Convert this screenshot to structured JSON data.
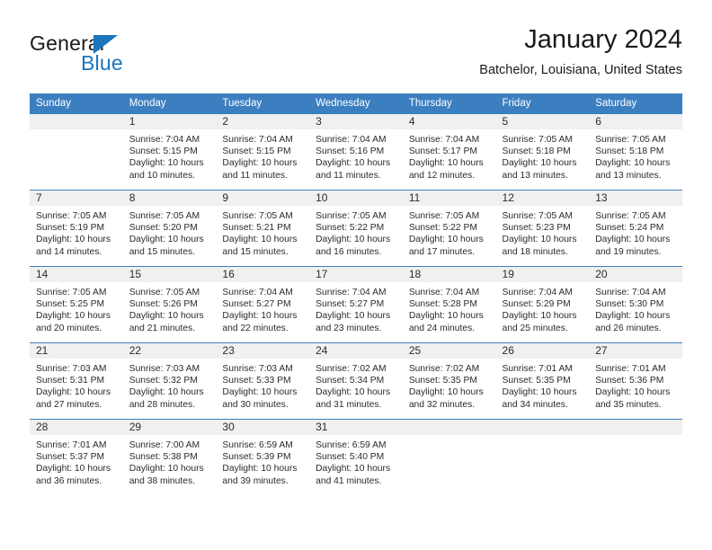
{
  "brand": {
    "name_top": "General",
    "name_bottom": "Blue",
    "accent_color": "#1b76bd"
  },
  "header": {
    "title": "January 2024",
    "subtitle": "Batchelor, Louisiana, United States"
  },
  "theme": {
    "header_bg": "#3c7fc1",
    "daynum_bg": "#f0f0f0",
    "text": "#2b2b2b"
  },
  "weekday_headers": [
    "Sunday",
    "Monday",
    "Tuesday",
    "Wednesday",
    "Thursday",
    "Friday",
    "Saturday"
  ],
  "weeks": [
    [
      {
        "day": "",
        "sunrise": "",
        "sunset": "",
        "daylight1": "",
        "daylight2": ""
      },
      {
        "day": "1",
        "sunrise": "Sunrise: 7:04 AM",
        "sunset": "Sunset: 5:15 PM",
        "daylight1": "Daylight: 10 hours",
        "daylight2": "and 10 minutes."
      },
      {
        "day": "2",
        "sunrise": "Sunrise: 7:04 AM",
        "sunset": "Sunset: 5:15 PM",
        "daylight1": "Daylight: 10 hours",
        "daylight2": "and 11 minutes."
      },
      {
        "day": "3",
        "sunrise": "Sunrise: 7:04 AM",
        "sunset": "Sunset: 5:16 PM",
        "daylight1": "Daylight: 10 hours",
        "daylight2": "and 11 minutes."
      },
      {
        "day": "4",
        "sunrise": "Sunrise: 7:04 AM",
        "sunset": "Sunset: 5:17 PM",
        "daylight1": "Daylight: 10 hours",
        "daylight2": "and 12 minutes."
      },
      {
        "day": "5",
        "sunrise": "Sunrise: 7:05 AM",
        "sunset": "Sunset: 5:18 PM",
        "daylight1": "Daylight: 10 hours",
        "daylight2": "and 13 minutes."
      },
      {
        "day": "6",
        "sunrise": "Sunrise: 7:05 AM",
        "sunset": "Sunset: 5:18 PM",
        "daylight1": "Daylight: 10 hours",
        "daylight2": "and 13 minutes."
      }
    ],
    [
      {
        "day": "7",
        "sunrise": "Sunrise: 7:05 AM",
        "sunset": "Sunset: 5:19 PM",
        "daylight1": "Daylight: 10 hours",
        "daylight2": "and 14 minutes."
      },
      {
        "day": "8",
        "sunrise": "Sunrise: 7:05 AM",
        "sunset": "Sunset: 5:20 PM",
        "daylight1": "Daylight: 10 hours",
        "daylight2": "and 15 minutes."
      },
      {
        "day": "9",
        "sunrise": "Sunrise: 7:05 AM",
        "sunset": "Sunset: 5:21 PM",
        "daylight1": "Daylight: 10 hours",
        "daylight2": "and 15 minutes."
      },
      {
        "day": "10",
        "sunrise": "Sunrise: 7:05 AM",
        "sunset": "Sunset: 5:22 PM",
        "daylight1": "Daylight: 10 hours",
        "daylight2": "and 16 minutes."
      },
      {
        "day": "11",
        "sunrise": "Sunrise: 7:05 AM",
        "sunset": "Sunset: 5:22 PM",
        "daylight1": "Daylight: 10 hours",
        "daylight2": "and 17 minutes."
      },
      {
        "day": "12",
        "sunrise": "Sunrise: 7:05 AM",
        "sunset": "Sunset: 5:23 PM",
        "daylight1": "Daylight: 10 hours",
        "daylight2": "and 18 minutes."
      },
      {
        "day": "13",
        "sunrise": "Sunrise: 7:05 AM",
        "sunset": "Sunset: 5:24 PM",
        "daylight1": "Daylight: 10 hours",
        "daylight2": "and 19 minutes."
      }
    ],
    [
      {
        "day": "14",
        "sunrise": "Sunrise: 7:05 AM",
        "sunset": "Sunset: 5:25 PM",
        "daylight1": "Daylight: 10 hours",
        "daylight2": "and 20 minutes."
      },
      {
        "day": "15",
        "sunrise": "Sunrise: 7:05 AM",
        "sunset": "Sunset: 5:26 PM",
        "daylight1": "Daylight: 10 hours",
        "daylight2": "and 21 minutes."
      },
      {
        "day": "16",
        "sunrise": "Sunrise: 7:04 AM",
        "sunset": "Sunset: 5:27 PM",
        "daylight1": "Daylight: 10 hours",
        "daylight2": "and 22 minutes."
      },
      {
        "day": "17",
        "sunrise": "Sunrise: 7:04 AM",
        "sunset": "Sunset: 5:27 PM",
        "daylight1": "Daylight: 10 hours",
        "daylight2": "and 23 minutes."
      },
      {
        "day": "18",
        "sunrise": "Sunrise: 7:04 AM",
        "sunset": "Sunset: 5:28 PM",
        "daylight1": "Daylight: 10 hours",
        "daylight2": "and 24 minutes."
      },
      {
        "day": "19",
        "sunrise": "Sunrise: 7:04 AM",
        "sunset": "Sunset: 5:29 PM",
        "daylight1": "Daylight: 10 hours",
        "daylight2": "and 25 minutes."
      },
      {
        "day": "20",
        "sunrise": "Sunrise: 7:04 AM",
        "sunset": "Sunset: 5:30 PM",
        "daylight1": "Daylight: 10 hours",
        "daylight2": "and 26 minutes."
      }
    ],
    [
      {
        "day": "21",
        "sunrise": "Sunrise: 7:03 AM",
        "sunset": "Sunset: 5:31 PM",
        "daylight1": "Daylight: 10 hours",
        "daylight2": "and 27 minutes."
      },
      {
        "day": "22",
        "sunrise": "Sunrise: 7:03 AM",
        "sunset": "Sunset: 5:32 PM",
        "daylight1": "Daylight: 10 hours",
        "daylight2": "and 28 minutes."
      },
      {
        "day": "23",
        "sunrise": "Sunrise: 7:03 AM",
        "sunset": "Sunset: 5:33 PM",
        "daylight1": "Daylight: 10 hours",
        "daylight2": "and 30 minutes."
      },
      {
        "day": "24",
        "sunrise": "Sunrise: 7:02 AM",
        "sunset": "Sunset: 5:34 PM",
        "daylight1": "Daylight: 10 hours",
        "daylight2": "and 31 minutes."
      },
      {
        "day": "25",
        "sunrise": "Sunrise: 7:02 AM",
        "sunset": "Sunset: 5:35 PM",
        "daylight1": "Daylight: 10 hours",
        "daylight2": "and 32 minutes."
      },
      {
        "day": "26",
        "sunrise": "Sunrise: 7:01 AM",
        "sunset": "Sunset: 5:35 PM",
        "daylight1": "Daylight: 10 hours",
        "daylight2": "and 34 minutes."
      },
      {
        "day": "27",
        "sunrise": "Sunrise: 7:01 AM",
        "sunset": "Sunset: 5:36 PM",
        "daylight1": "Daylight: 10 hours",
        "daylight2": "and 35 minutes."
      }
    ],
    [
      {
        "day": "28",
        "sunrise": "Sunrise: 7:01 AM",
        "sunset": "Sunset: 5:37 PM",
        "daylight1": "Daylight: 10 hours",
        "daylight2": "and 36 minutes."
      },
      {
        "day": "29",
        "sunrise": "Sunrise: 7:00 AM",
        "sunset": "Sunset: 5:38 PM",
        "daylight1": "Daylight: 10 hours",
        "daylight2": "and 38 minutes."
      },
      {
        "day": "30",
        "sunrise": "Sunrise: 6:59 AM",
        "sunset": "Sunset: 5:39 PM",
        "daylight1": "Daylight: 10 hours",
        "daylight2": "and 39 minutes."
      },
      {
        "day": "31",
        "sunrise": "Sunrise: 6:59 AM",
        "sunset": "Sunset: 5:40 PM",
        "daylight1": "Daylight: 10 hours",
        "daylight2": "and 41 minutes."
      },
      {
        "day": "",
        "sunrise": "",
        "sunset": "",
        "daylight1": "",
        "daylight2": ""
      },
      {
        "day": "",
        "sunrise": "",
        "sunset": "",
        "daylight1": "",
        "daylight2": ""
      },
      {
        "day": "",
        "sunrise": "",
        "sunset": "",
        "daylight1": "",
        "daylight2": ""
      }
    ]
  ]
}
